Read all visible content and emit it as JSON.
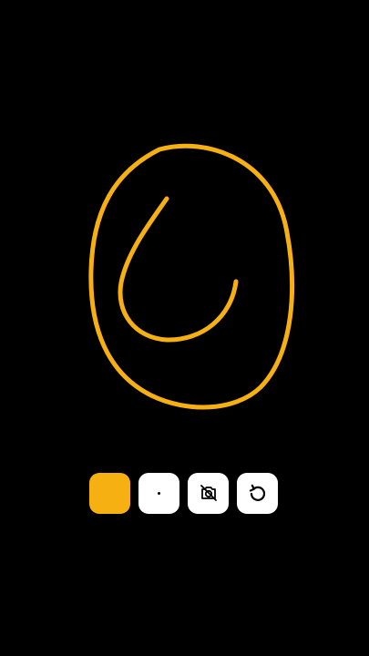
{
  "drawing": {
    "stroke_color": "#f6b012",
    "background": "#000000",
    "strokes": [
      "outer-loop",
      "inner-curve"
    ]
  },
  "toolbar": {
    "buttons": [
      {
        "name": "color-swatch-button",
        "icon": "color-swatch",
        "color": "#f6b012"
      },
      {
        "name": "brush-size-button",
        "icon": "dot-icon"
      },
      {
        "name": "camera-off-button",
        "icon": "camera-off-icon"
      },
      {
        "name": "undo-button",
        "icon": "undo-icon"
      }
    ]
  }
}
